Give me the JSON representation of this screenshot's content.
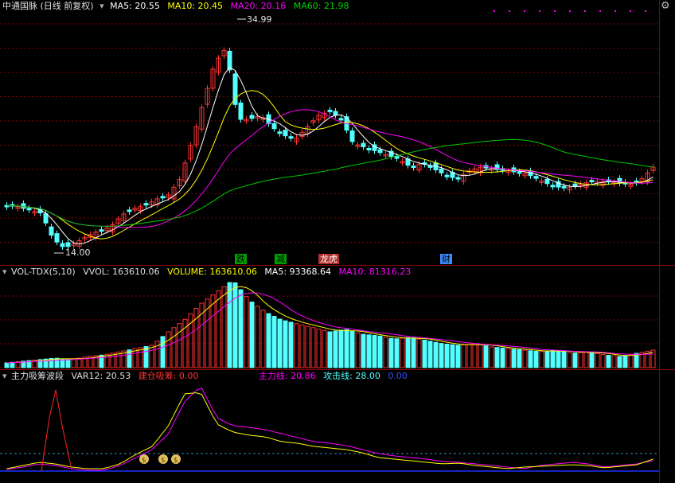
{
  "main": {
    "title": "中通国脉 (日线 前复权)",
    "ma5": "MA5: 20.55",
    "ma10": "MA10: 20.45",
    "ma20": "MA20: 20.16",
    "ma60": "MA60: 21.98",
    "high_label": "34.99",
    "low_label": "14.00",
    "event_labels": [
      "跌",
      "减",
      "龙虎",
      "财"
    ]
  },
  "vol": {
    "title": "VOL-TDX(5,10)",
    "vvol": "VVOL: 163610.06",
    "volume": "VOLUME: 163610.06",
    "ma5": "MA5: 93368.64",
    "ma10": "MA10: 81316.23"
  },
  "ind": {
    "title": "主力吸筹波段",
    "var12": "VAR12: 20.53",
    "jiancang": "建仓吸筹: 0.00",
    "zhuli": "主力线: 20.86",
    "gongji": "攻击线: 28.00",
    "zero": "0.00"
  },
  "colors": {
    "up": "#ff3232",
    "down": "#54ffff",
    "ma5": "#ffffff",
    "ma10": "#ffff00",
    "ma20": "#ff00ff",
    "ma60": "#00c800",
    "grid": "#8b0000"
  },
  "icons": [
    "gear-icon",
    "chevron-down-icon",
    "moneybag-icon"
  ]
}
